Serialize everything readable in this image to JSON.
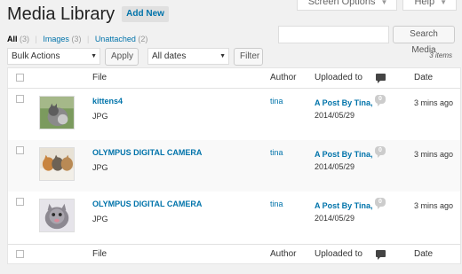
{
  "header": {
    "title": "Media Library",
    "add_new": "Add New"
  },
  "screen_tabs": {
    "screen_options": "Screen Options",
    "help": "Help"
  },
  "filters": [
    {
      "label": "All",
      "count": "(3)"
    },
    {
      "label": "Images",
      "count": "(3)"
    },
    {
      "label": "Unattached",
      "count": "(2)"
    }
  ],
  "search": {
    "value": "",
    "button": "Search Media"
  },
  "bulk": {
    "selected": "Bulk Actions",
    "apply": "Apply"
  },
  "dates": {
    "selected": "All dates",
    "filter": "Filter"
  },
  "items_count": "3 items",
  "columns": {
    "file": "File",
    "author": "Author",
    "uploaded_to": "Uploaded to",
    "date": "Date"
  },
  "rows": [
    {
      "title": "kittens4",
      "type": "JPG",
      "author": "tina",
      "post": "A Post By Tina,",
      "post_date": "2014/05/29",
      "comments": "0",
      "date": "3 mins ago"
    },
    {
      "title": "OLYMPUS DIGITAL CAMERA",
      "type": "JPG",
      "author": "tina",
      "post": "A Post By Tina,",
      "post_date": "2014/05/29",
      "comments": "0",
      "date": "3 mins ago"
    },
    {
      "title": "OLYMPUS DIGITAL CAMERA",
      "type": "JPG",
      "author": "tina",
      "post": "A Post By Tina,",
      "post_date": "2014/05/29",
      "comments": "0",
      "date": "3 mins ago"
    }
  ],
  "colors": {
    "link": "#0073aa",
    "background": "#f1f1f1"
  },
  "icons": {
    "comments_column": "comment-bubble-icon",
    "dropdown": "chevron-down-icon"
  }
}
